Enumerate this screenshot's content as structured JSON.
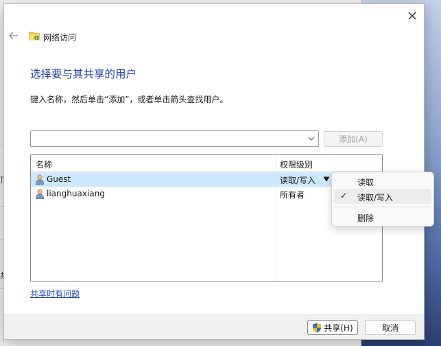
{
  "background": {
    "left_chars": [
      "顶",
      "共"
    ]
  },
  "header": {
    "title": "网络访问"
  },
  "main": {
    "heading": "选择要与其共享的用户",
    "instruction": "键入名称，然后单击“添加”，或者单击箭头查找用户。",
    "combo_value": "",
    "add_button": "添加(A)"
  },
  "list": {
    "columns": [
      "名称",
      "权限级别"
    ],
    "rows": [
      {
        "name": "Guest",
        "permission": "读取/写入",
        "selected": true
      },
      {
        "name": "lianghuaxiang",
        "permission": "所有者",
        "selected": false
      }
    ]
  },
  "menu": {
    "items": [
      {
        "label": "读取",
        "checked": false
      },
      {
        "label": "读取/写入",
        "checked": true
      },
      {
        "label": "删除",
        "checked": false
      }
    ],
    "check_glyph": "✓"
  },
  "links": {
    "help": "共享时有问题"
  },
  "footer": {
    "share_button": "共享(H)",
    "cancel_button": "取消"
  },
  "colors": {
    "heading": "#1e3fa3",
    "link": "#1d4fb8",
    "selected_row": "#cce8ff"
  }
}
